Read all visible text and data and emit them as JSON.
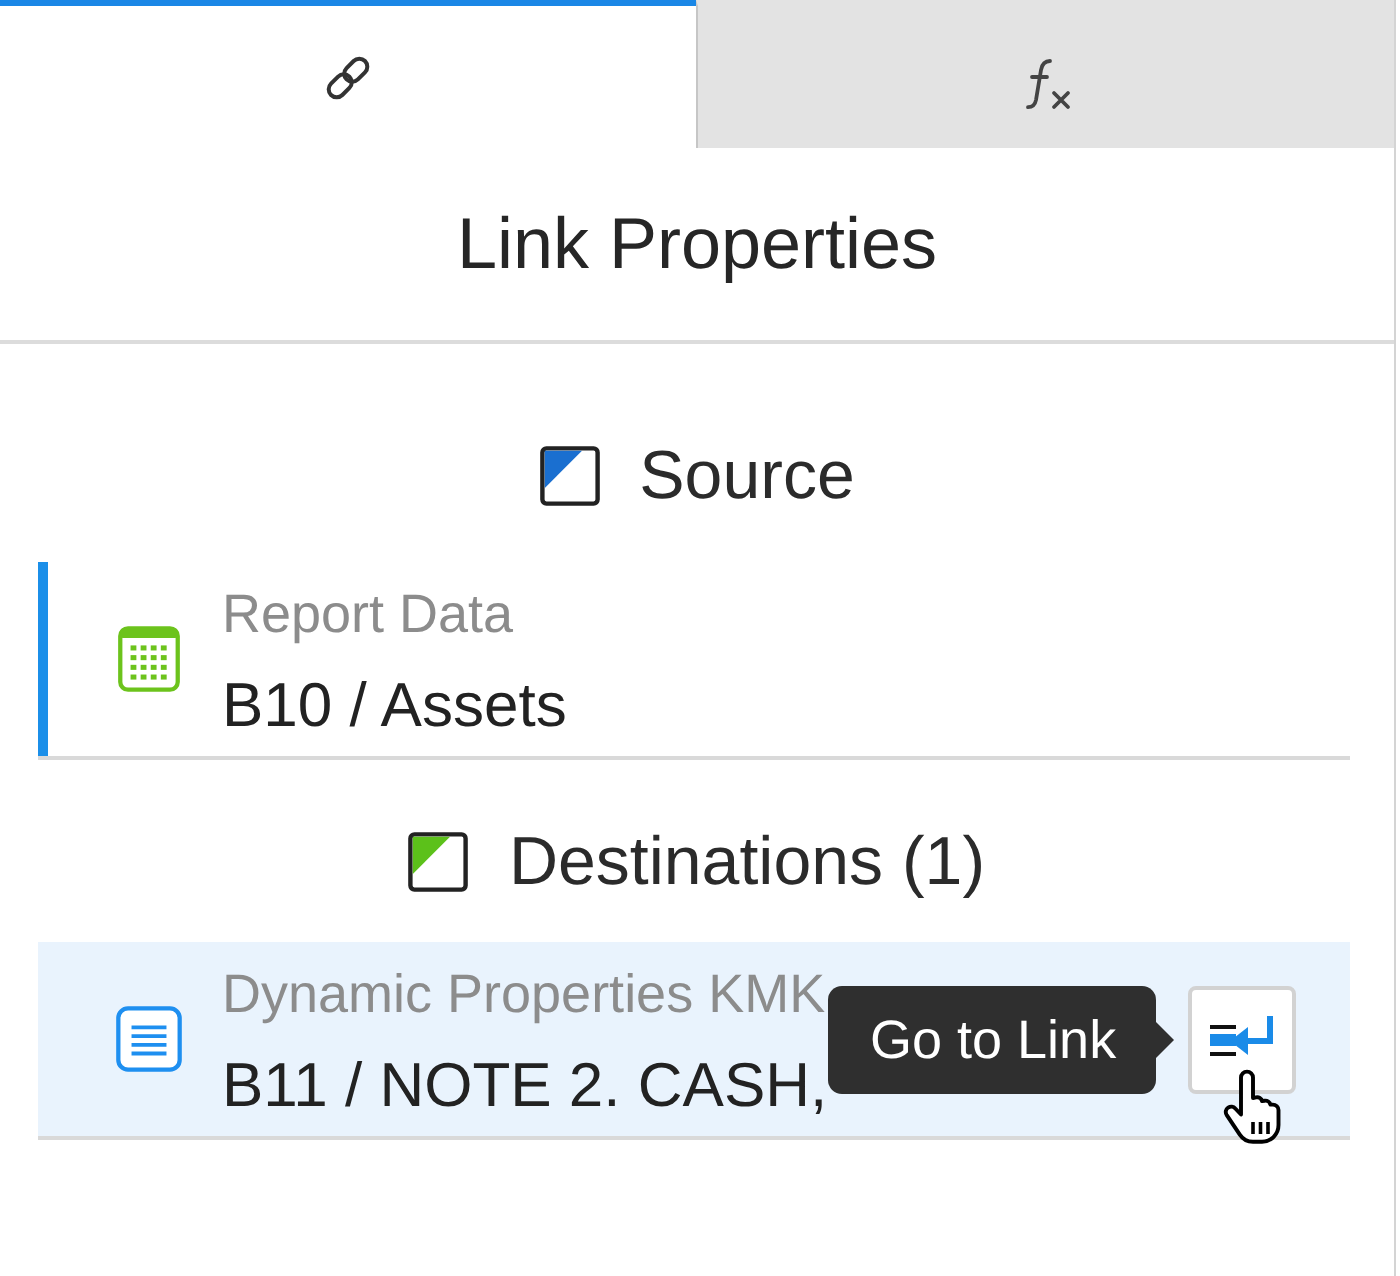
{
  "tabs": [
    {
      "kind": "link",
      "selected": true
    },
    {
      "kind": "formula",
      "selected": false
    }
  ],
  "title": "Link Properties",
  "source": {
    "heading": "Source",
    "items": [
      {
        "kind": "sheet",
        "name": "Report Data",
        "cell": "B10 / Assets",
        "selected": true,
        "hovered": false
      }
    ]
  },
  "destinations": {
    "heading": "Destinations (1)",
    "items": [
      {
        "kind": "document",
        "name": "Dynamic Properties KMK",
        "cell": "B11 / NOTE 2. CASH,",
        "selected": false,
        "hovered": true,
        "tooltip": "Go to Link"
      }
    ]
  }
}
